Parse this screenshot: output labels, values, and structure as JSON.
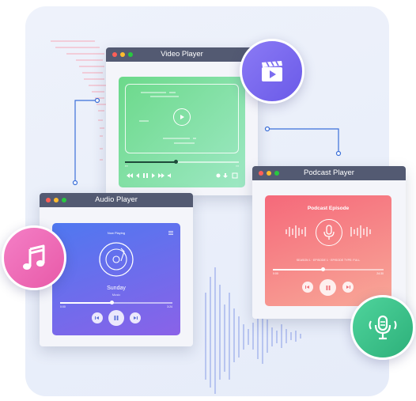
{
  "video_player": {
    "title": "Video Player"
  },
  "audio_player": {
    "title": "Audio Player",
    "header": "Now Playing",
    "song_title": "Sunday",
    "song_artist": "Music",
    "time_elapsed": "0:00",
    "time_total": "3:24",
    "progress": 0.46
  },
  "podcast_player": {
    "title": "Podcast Player",
    "heading": "Podcast Episode",
    "meta": "SEASON 1 · EPISODE 1 · EPISODE TYPE: FULL",
    "time_elapsed": "0:00",
    "time_total": "24:30",
    "progress": 0.45
  },
  "video_progress": 0.45,
  "colors": {
    "titlebar": "#535a72",
    "video_gradient": [
      "#6bd98a",
      "#9ee8c4"
    ],
    "audio_gradient": [
      "#4f78f0",
      "#8a62e8"
    ],
    "podcast_gradient": [
      "#f5697a",
      "#f8a898"
    ],
    "music_badge": "#f06bb8",
    "video_badge": "#7b6cf0",
    "mic_badge": "#36c08a"
  },
  "icons": [
    "music-note-icon",
    "video-clapper-icon",
    "microphone-icon",
    "play-icon",
    "pause-icon",
    "skip-back-icon",
    "skip-forward-icon",
    "vinyl-disc-icon",
    "menu-icon",
    "settings-icon",
    "download-icon",
    "fullscreen-icon"
  ]
}
